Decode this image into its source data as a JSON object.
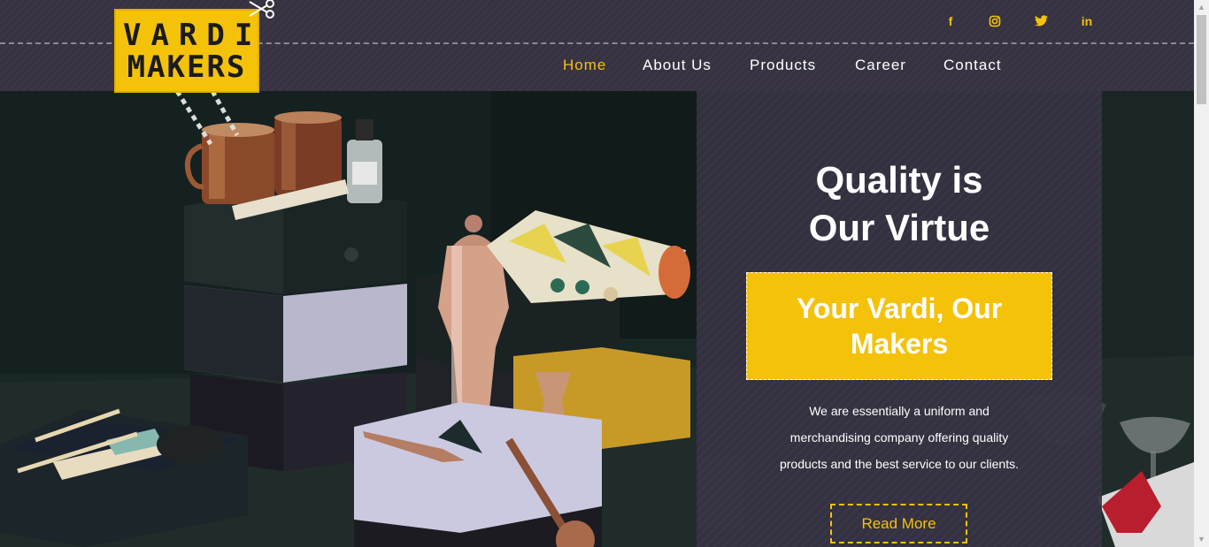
{
  "logo": {
    "line1": "VARDI",
    "line2": "MAKERS",
    "scissors_icon": "scissors-icon"
  },
  "social": [
    {
      "name": "facebook-icon",
      "glyph": "f"
    },
    {
      "name": "instagram-icon",
      "glyph": "◎"
    },
    {
      "name": "twitter-icon",
      "glyph": "🐦"
    },
    {
      "name": "linkedin-icon",
      "glyph": "in"
    }
  ],
  "nav": {
    "items": [
      {
        "label": "Home",
        "active": true
      },
      {
        "label": "About Us",
        "active": false
      },
      {
        "label": "Products",
        "active": false
      },
      {
        "label": "Career",
        "active": false
      },
      {
        "label": "Contact",
        "active": false
      }
    ]
  },
  "hero": {
    "heading_line1": "Quality is",
    "heading_line2": "Our Virtue",
    "tagline_line1": "Your Vardi, Our",
    "tagline_line2": "Makers",
    "desc_line1": "We are essentially a uniform and",
    "desc_line2": "merchandising company offering quality",
    "desc_line3": "products and the best service to our clients.",
    "button_label": "Read More"
  },
  "colors": {
    "accent": "#f5c20a",
    "header_bg": "#363241",
    "panel_bg": "#363242",
    "text": "#ffffff"
  }
}
